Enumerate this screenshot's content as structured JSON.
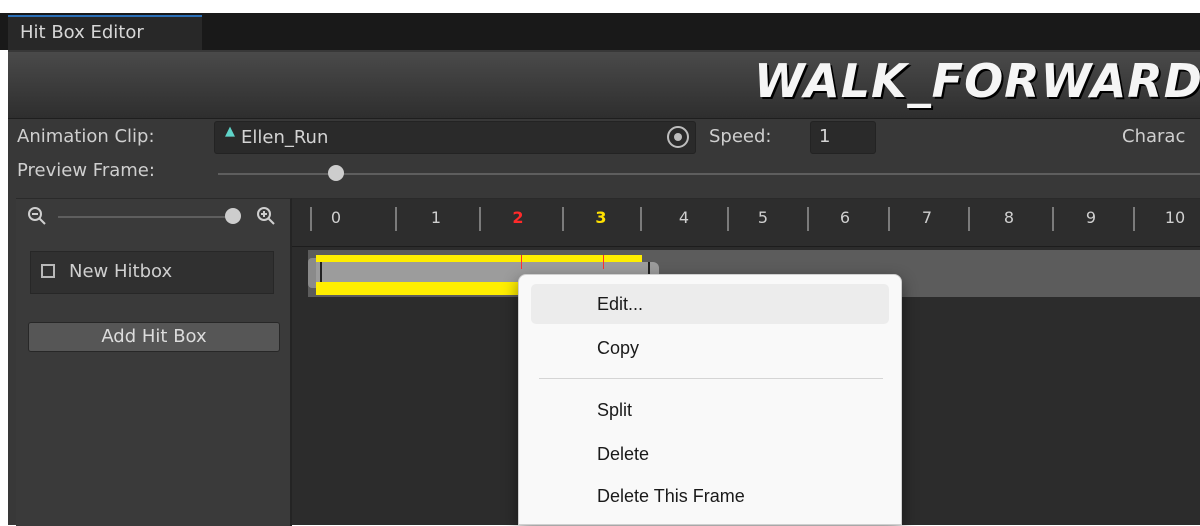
{
  "window": {
    "tab_title": "Hit Box Editor"
  },
  "banner": {
    "title": "WALK_FORWARD_MAF"
  },
  "fields": {
    "animation_clip_label": "Animation Clip:",
    "animation_clip_value": "Ellen_Run",
    "speed_label": "Speed:",
    "speed_value": "1",
    "character_label": "Charac",
    "preview_frame_label": "Preview Frame:"
  },
  "hitboxes": {
    "items": [
      {
        "label": "New Hitbox",
        "checked": false
      }
    ],
    "add_button": "Add Hit Box"
  },
  "timeline": {
    "frames": [
      "0",
      "1",
      "2",
      "3",
      "4",
      "5",
      "6",
      "7",
      "8",
      "9",
      "10"
    ],
    "active_red_frame": "2",
    "active_yellow_frame": "3"
  },
  "context_menu": {
    "items": [
      "Edit...",
      "Copy",
      "Split",
      "Delete",
      "Delete This Frame"
    ],
    "highlighted": "Edit..."
  },
  "colors": {
    "hitbox_bar": "#ffee00",
    "accent_red": "#ff2a2a",
    "accent_yellow": "#ffe100"
  }
}
